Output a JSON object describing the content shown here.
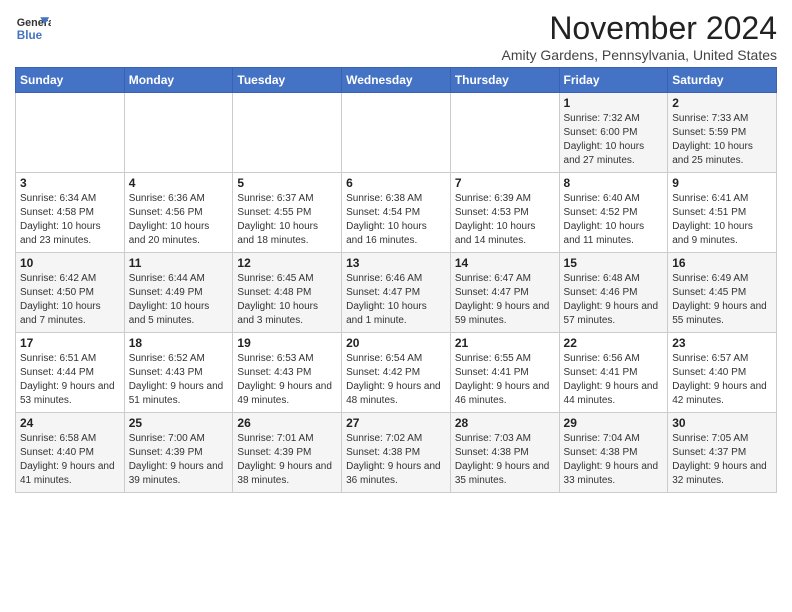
{
  "header": {
    "logo_line1": "General",
    "logo_line2": "Blue",
    "month": "November 2024",
    "location": "Amity Gardens, Pennsylvania, United States"
  },
  "weekdays": [
    "Sunday",
    "Monday",
    "Tuesday",
    "Wednesday",
    "Thursday",
    "Friday",
    "Saturday"
  ],
  "weeks": [
    [
      {
        "day": "",
        "info": ""
      },
      {
        "day": "",
        "info": ""
      },
      {
        "day": "",
        "info": ""
      },
      {
        "day": "",
        "info": ""
      },
      {
        "day": "",
        "info": ""
      },
      {
        "day": "1",
        "info": "Sunrise: 7:32 AM\nSunset: 6:00 PM\nDaylight: 10 hours and 27 minutes."
      },
      {
        "day": "2",
        "info": "Sunrise: 7:33 AM\nSunset: 5:59 PM\nDaylight: 10 hours and 25 minutes."
      }
    ],
    [
      {
        "day": "3",
        "info": "Sunrise: 6:34 AM\nSunset: 4:58 PM\nDaylight: 10 hours and 23 minutes."
      },
      {
        "day": "4",
        "info": "Sunrise: 6:36 AM\nSunset: 4:56 PM\nDaylight: 10 hours and 20 minutes."
      },
      {
        "day": "5",
        "info": "Sunrise: 6:37 AM\nSunset: 4:55 PM\nDaylight: 10 hours and 18 minutes."
      },
      {
        "day": "6",
        "info": "Sunrise: 6:38 AM\nSunset: 4:54 PM\nDaylight: 10 hours and 16 minutes."
      },
      {
        "day": "7",
        "info": "Sunrise: 6:39 AM\nSunset: 4:53 PM\nDaylight: 10 hours and 14 minutes."
      },
      {
        "day": "8",
        "info": "Sunrise: 6:40 AM\nSunset: 4:52 PM\nDaylight: 10 hours and 11 minutes."
      },
      {
        "day": "9",
        "info": "Sunrise: 6:41 AM\nSunset: 4:51 PM\nDaylight: 10 hours and 9 minutes."
      }
    ],
    [
      {
        "day": "10",
        "info": "Sunrise: 6:42 AM\nSunset: 4:50 PM\nDaylight: 10 hours and 7 minutes."
      },
      {
        "day": "11",
        "info": "Sunrise: 6:44 AM\nSunset: 4:49 PM\nDaylight: 10 hours and 5 minutes."
      },
      {
        "day": "12",
        "info": "Sunrise: 6:45 AM\nSunset: 4:48 PM\nDaylight: 10 hours and 3 minutes."
      },
      {
        "day": "13",
        "info": "Sunrise: 6:46 AM\nSunset: 4:47 PM\nDaylight: 10 hours and 1 minute."
      },
      {
        "day": "14",
        "info": "Sunrise: 6:47 AM\nSunset: 4:47 PM\nDaylight: 9 hours and 59 minutes."
      },
      {
        "day": "15",
        "info": "Sunrise: 6:48 AM\nSunset: 4:46 PM\nDaylight: 9 hours and 57 minutes."
      },
      {
        "day": "16",
        "info": "Sunrise: 6:49 AM\nSunset: 4:45 PM\nDaylight: 9 hours and 55 minutes."
      }
    ],
    [
      {
        "day": "17",
        "info": "Sunrise: 6:51 AM\nSunset: 4:44 PM\nDaylight: 9 hours and 53 minutes."
      },
      {
        "day": "18",
        "info": "Sunrise: 6:52 AM\nSunset: 4:43 PM\nDaylight: 9 hours and 51 minutes."
      },
      {
        "day": "19",
        "info": "Sunrise: 6:53 AM\nSunset: 4:43 PM\nDaylight: 9 hours and 49 minutes."
      },
      {
        "day": "20",
        "info": "Sunrise: 6:54 AM\nSunset: 4:42 PM\nDaylight: 9 hours and 48 minutes."
      },
      {
        "day": "21",
        "info": "Sunrise: 6:55 AM\nSunset: 4:41 PM\nDaylight: 9 hours and 46 minutes."
      },
      {
        "day": "22",
        "info": "Sunrise: 6:56 AM\nSunset: 4:41 PM\nDaylight: 9 hours and 44 minutes."
      },
      {
        "day": "23",
        "info": "Sunrise: 6:57 AM\nSunset: 4:40 PM\nDaylight: 9 hours and 42 minutes."
      }
    ],
    [
      {
        "day": "24",
        "info": "Sunrise: 6:58 AM\nSunset: 4:40 PM\nDaylight: 9 hours and 41 minutes."
      },
      {
        "day": "25",
        "info": "Sunrise: 7:00 AM\nSunset: 4:39 PM\nDaylight: 9 hours and 39 minutes."
      },
      {
        "day": "26",
        "info": "Sunrise: 7:01 AM\nSunset: 4:39 PM\nDaylight: 9 hours and 38 minutes."
      },
      {
        "day": "27",
        "info": "Sunrise: 7:02 AM\nSunset: 4:38 PM\nDaylight: 9 hours and 36 minutes."
      },
      {
        "day": "28",
        "info": "Sunrise: 7:03 AM\nSunset: 4:38 PM\nDaylight: 9 hours and 35 minutes."
      },
      {
        "day": "29",
        "info": "Sunrise: 7:04 AM\nSunset: 4:38 PM\nDaylight: 9 hours and 33 minutes."
      },
      {
        "day": "30",
        "info": "Sunrise: 7:05 AM\nSunset: 4:37 PM\nDaylight: 9 hours and 32 minutes."
      }
    ]
  ]
}
